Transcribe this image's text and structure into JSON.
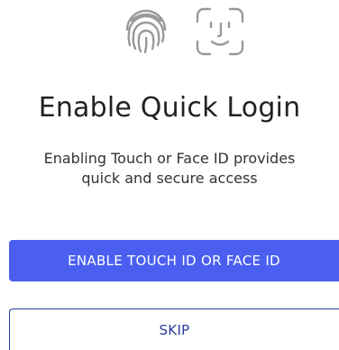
{
  "icons": [
    "fingerprint-icon",
    "face-id-icon"
  ],
  "title": "Enable Quick Login",
  "subtitle": "Enabling Touch or Face ID provides quick and secure access",
  "primary_button": {
    "label": "ENABLE TOUCH ID OR FACE ID"
  },
  "secondary_button": {
    "label": "SKIP"
  },
  "colors": {
    "primary": "#4a5ff0",
    "outline": "#2b3b9a",
    "icon": "#9a9a9a",
    "text": "#222222"
  }
}
